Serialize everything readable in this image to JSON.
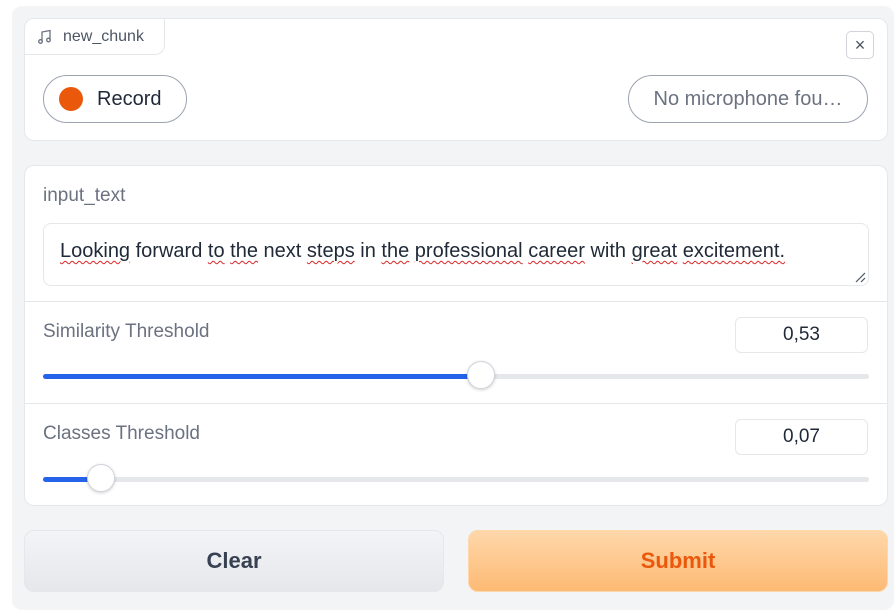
{
  "audio": {
    "label": "new_chunk",
    "record_label": "Record",
    "mic_label": "No microphone fou…",
    "close_symbol": "×",
    "icon": "music-note-icon",
    "record_color": "#ea580c"
  },
  "input_text": {
    "label": "input_text",
    "value_words": [
      "Looking",
      "forward",
      "to",
      "the",
      "next",
      "steps",
      "in",
      "the",
      "professional",
      "career",
      "with",
      "great",
      "excitement."
    ]
  },
  "similarity": {
    "label": "Similarity Threshold",
    "value": "0,53",
    "fraction": 0.53
  },
  "classes": {
    "label": "Classes Threshold",
    "value": "0,07",
    "fraction": 0.07
  },
  "buttons": {
    "clear": "Clear",
    "submit": "Submit"
  },
  "colors": {
    "accent": "#2563eb",
    "submit_text": "#ea580c"
  }
}
